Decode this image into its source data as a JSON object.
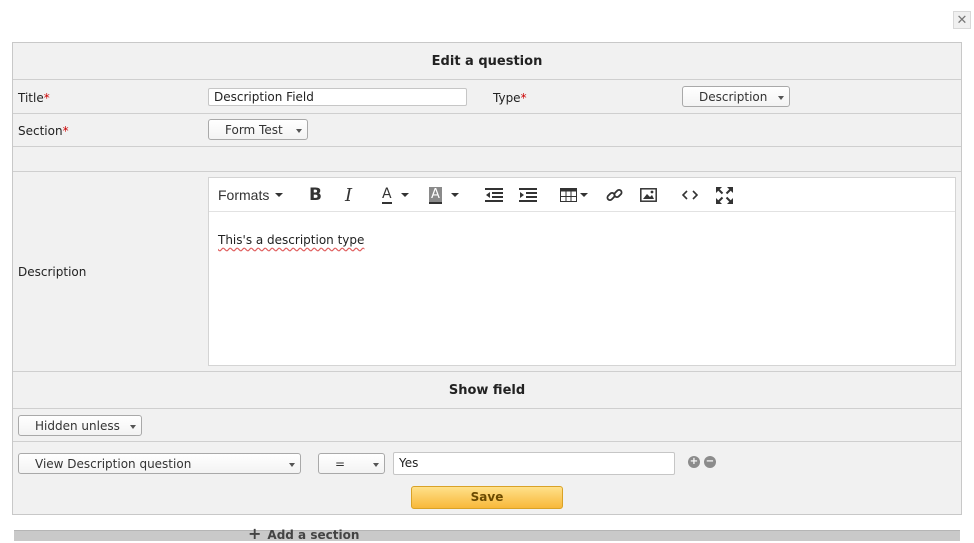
{
  "dialog": {
    "close_icon": "close-icon"
  },
  "form": {
    "title": "Edit a question",
    "fields": {
      "title_label": "Title",
      "title_value": "Description Field",
      "type_label": "Type",
      "type_value": "Description",
      "section_label": "Section",
      "section_value": "Form Test",
      "description_label": "Description",
      "required_mark": "*"
    },
    "editor": {
      "formats_label": "Formats",
      "content": "This's a description type",
      "toolbar_icons": [
        "bold-icon",
        "italic-icon",
        "text-color-icon",
        "background-color-icon",
        "outdent-icon",
        "indent-icon",
        "table-icon",
        "link-icon",
        "image-icon",
        "code-icon",
        "fullscreen-icon"
      ]
    },
    "show_field": {
      "title": "Show field",
      "visibility_value": "Hidden unless",
      "condition_question": "View Description question",
      "condition_operator": "=",
      "condition_value": "Yes"
    },
    "save_label": "Save"
  },
  "background": {
    "add_section_label": "Add a section"
  },
  "colors": {
    "save_button": "#f8b83a",
    "required": "#cc0000",
    "panel_bg": "#f1f1f1"
  }
}
